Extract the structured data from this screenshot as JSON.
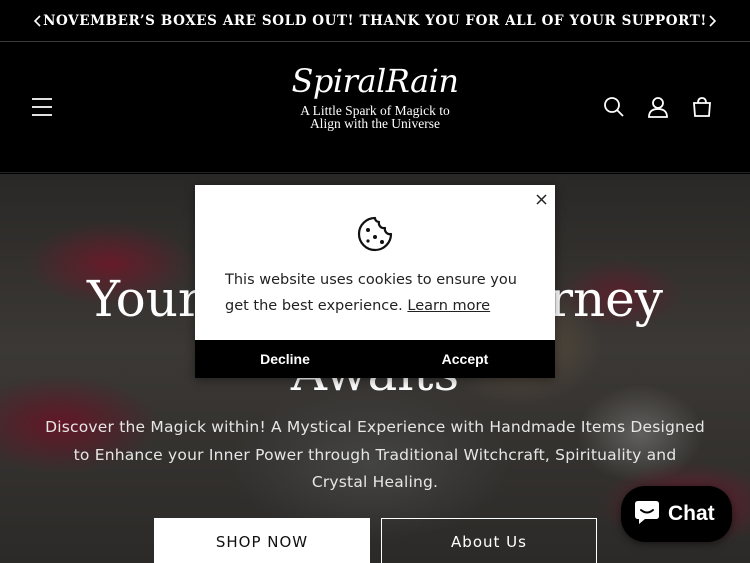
{
  "announcement": {
    "text": "NOVEMBER’S BOXES ARE SOLD OUT! THANK YOU FOR ALL OF YOUR SUPPORT!",
    "prev_icon": "chevron-left-icon",
    "next_icon": "chevron-right-icon"
  },
  "header": {
    "logo_title": "SpiralRain",
    "logo_tagline": "A Little Spark of Magick to Align with the Universe",
    "icons": [
      "menu-icon",
      "search-icon",
      "account-icon",
      "cart-icon"
    ]
  },
  "hero": {
    "title_line1": "Your Magickal Journey",
    "title_line2": "Awaits",
    "description": "Discover the Magick within! A Mystical Experience with Handmade Items Designed to Enhance your Inner Power through Traditional Witchcraft, Spirituality and Crystal Healing.",
    "primary_button": "SHOP NOW",
    "secondary_button": "About Us"
  },
  "cookie_banner": {
    "icon": "cookie-icon",
    "message": "This website uses cookies to ensure you get the best experience.",
    "link_text": "Learn more",
    "decline": "Decline",
    "accept": "Accept",
    "close_icon": "close-icon"
  },
  "chat_widget": {
    "label": "Chat",
    "icon": "chat-bubble-icon",
    "accent": "#000000"
  }
}
